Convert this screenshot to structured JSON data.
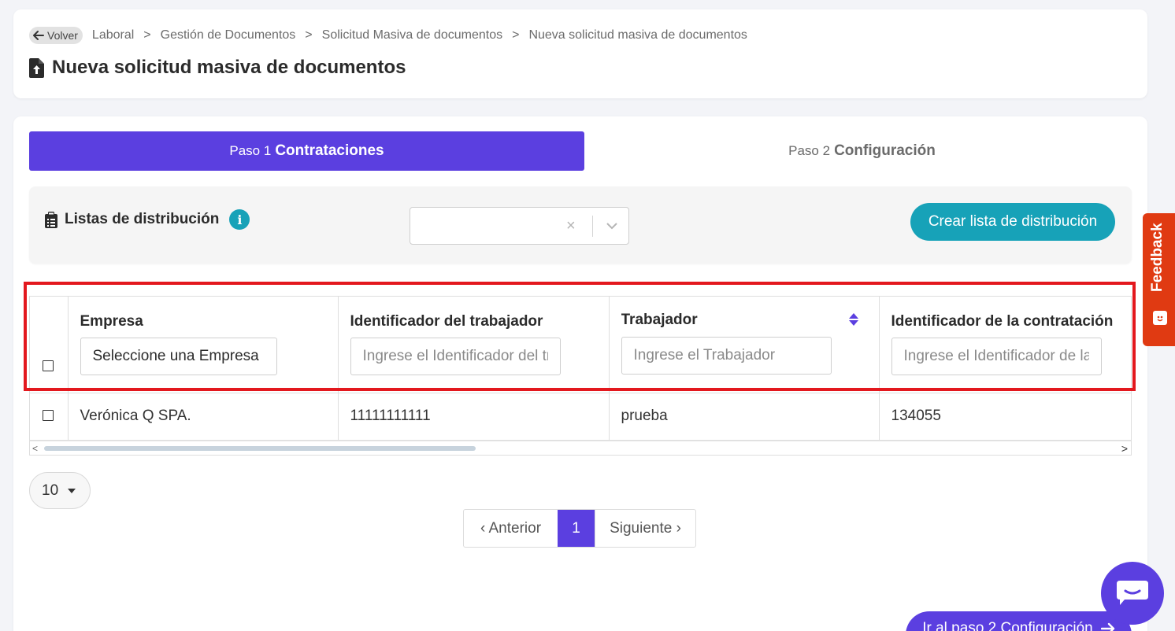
{
  "breadcrumb": {
    "back_label": "Volver",
    "items": [
      "Laboral",
      "Gestión de Documentos",
      "Solicitud Masiva de documentos",
      "Nueva solicitud masiva de documentos"
    ],
    "separator": ">"
  },
  "page_title": "Nueva solicitud masiva de documentos",
  "steps": [
    {
      "prefix": "Paso 1",
      "label": "Contrataciones",
      "active": true
    },
    {
      "prefix": "Paso 2",
      "label": "Configuración",
      "active": false
    }
  ],
  "distribution": {
    "label": "Listas de distribución",
    "info_icon": "i",
    "select_value": "",
    "clear_icon": "×",
    "create_button": "Crear lista de distribución"
  },
  "table": {
    "columns": [
      {
        "header": "Empresa",
        "filter_value": "Seleccione una Empresa",
        "filter_type": "select"
      },
      {
        "header": "Identificador del trabajador",
        "filter_placeholder": "Ingrese el Identificador del trabajador",
        "filter_type": "text"
      },
      {
        "header": "Trabajador",
        "filter_placeholder": "Ingrese el Trabajador",
        "filter_type": "text",
        "sortable": true
      },
      {
        "header": "Identificador de la contratación",
        "filter_placeholder": "Ingrese el Identificador de la contratación",
        "filter_type": "text"
      }
    ],
    "rows": [
      {
        "empresa": "Verónica Q SPA.",
        "id_trabajador": "11111111111",
        "trabajador": "prueba",
        "id_contratacion": "134055"
      }
    ],
    "scroll_left": "<",
    "scroll_right": ">"
  },
  "page_size": "10",
  "pagination": {
    "prev": "‹ Anterior",
    "current": "1",
    "next": "Siguiente ›"
  },
  "next_step_button": "Ir al paso 2 Configuración",
  "feedback_label": "Feedback",
  "colors": {
    "primary": "#5b3fe0",
    "teal": "#17a2b8",
    "feedback": "#e03a12",
    "highlight": "#e3181e"
  }
}
